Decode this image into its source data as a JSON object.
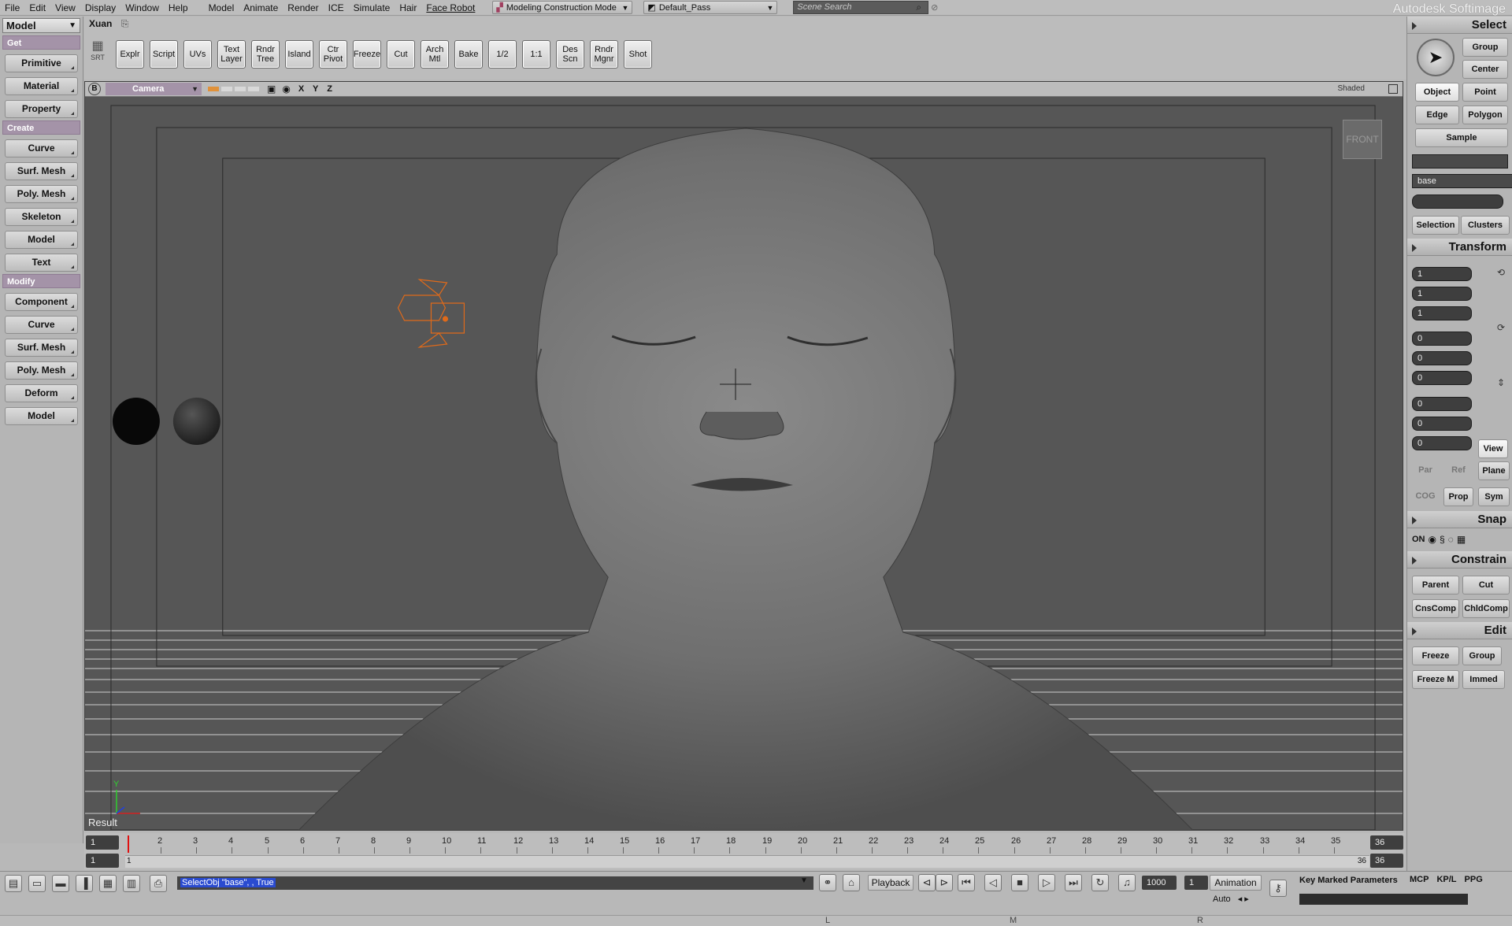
{
  "menubar": {
    "items": [
      "File",
      "Edit",
      "View",
      "Display",
      "Window",
      "Help",
      "Model",
      "Animate",
      "Render",
      "ICE",
      "Simulate",
      "Hair",
      "Face Robot"
    ],
    "construction_mode": "Modeling Construction Mode",
    "pass": "Default_Pass",
    "search_placeholder": "Scene Search",
    "brand": "Autodesk Softimage"
  },
  "left_panel": {
    "mode": "Model",
    "sections": [
      {
        "title": "Get",
        "buttons": [
          "Primitive",
          "Material",
          "Property"
        ]
      },
      {
        "title": "Create",
        "buttons": [
          "Curve",
          "Surf. Mesh",
          "Poly. Mesh",
          "Skeleton",
          "Model",
          "Text"
        ]
      },
      {
        "title": "Modify",
        "buttons": [
          "Component",
          "Curve",
          "Surf. Mesh",
          "Poly. Mesh",
          "Deform",
          "Model"
        ]
      }
    ]
  },
  "toolbar": {
    "tab": "Xuan",
    "srt": "SRT",
    "buttons": [
      "Explr",
      "Script",
      "UVs",
      "Text Layer",
      "Rndr Tree",
      "Island",
      "Ctr Pivot",
      "Freeze",
      "Cut",
      "Arch Mtl",
      "Bake",
      "1/2",
      "1:1",
      "Des Scn",
      "Rndr Mgnr",
      "Shot"
    ]
  },
  "viewport": {
    "badge": "B",
    "camera": "Camera",
    "axes": "X Y Z",
    "display_mode": "Shaded",
    "view_label": "FRONT",
    "result_label": "Result",
    "axis_y": "Y"
  },
  "right_panel": {
    "select_header": "Select",
    "select_buttons": {
      "group": "Group",
      "center": "Center",
      "object": "Object",
      "point": "Point",
      "edge": "Edge",
      "polygon": "Polygon",
      "sample": "Sample"
    },
    "selection_name": "base",
    "selection_btns": {
      "selection": "Selection",
      "clusters": "Clusters"
    },
    "transform_header": "Transform",
    "transform_values": [
      "1",
      "1",
      "1",
      "0",
      "0",
      "0",
      "0",
      "0",
      "0"
    ],
    "transform_btns": {
      "view": "View",
      "par": "Par",
      "ref": "Ref",
      "plane": "Plane",
      "cog": "COG",
      "prop": "Prop",
      "sym": "Sym"
    },
    "snap_header": "Snap",
    "snap_on": "ON",
    "constrain_header": "Constrain",
    "constrain_btns": {
      "parent": "Parent",
      "cut": "Cut",
      "cnscomp": "CnsComp",
      "chldcomp": "ChldComp"
    },
    "edit_header": "Edit",
    "edit_btns": {
      "freeze": "Freeze",
      "group": "Group",
      "freeze_m": "Freeze M",
      "immed": "Immed"
    }
  },
  "timeline": {
    "start_frame": "1",
    "start_range": "1",
    "range_start_label": "1",
    "ticks": [
      "2",
      "3",
      "4",
      "5",
      "6",
      "7",
      "8",
      "9",
      "10",
      "11",
      "12",
      "13",
      "14",
      "15",
      "16",
      "17",
      "18",
      "19",
      "20",
      "21",
      "22",
      "23",
      "24",
      "25",
      "26",
      "27",
      "28",
      "29",
      "30",
      "31",
      "32",
      "33",
      "34",
      "35"
    ],
    "end_frame": "36",
    "end_range": "36",
    "range_end_label": "36"
  },
  "bottom_bar": {
    "script_line": "SelectObj \"base\", , True",
    "playback": "Playback",
    "frame_count": "1000",
    "current_frame": "1",
    "animation": "Animation",
    "auto": "Auto",
    "key_marked": "Key Marked Parameters",
    "tabs": [
      "MCP",
      "KP/L",
      "PPG"
    ]
  },
  "statusbar": {
    "l": "L",
    "m": "M",
    "r": "R"
  }
}
